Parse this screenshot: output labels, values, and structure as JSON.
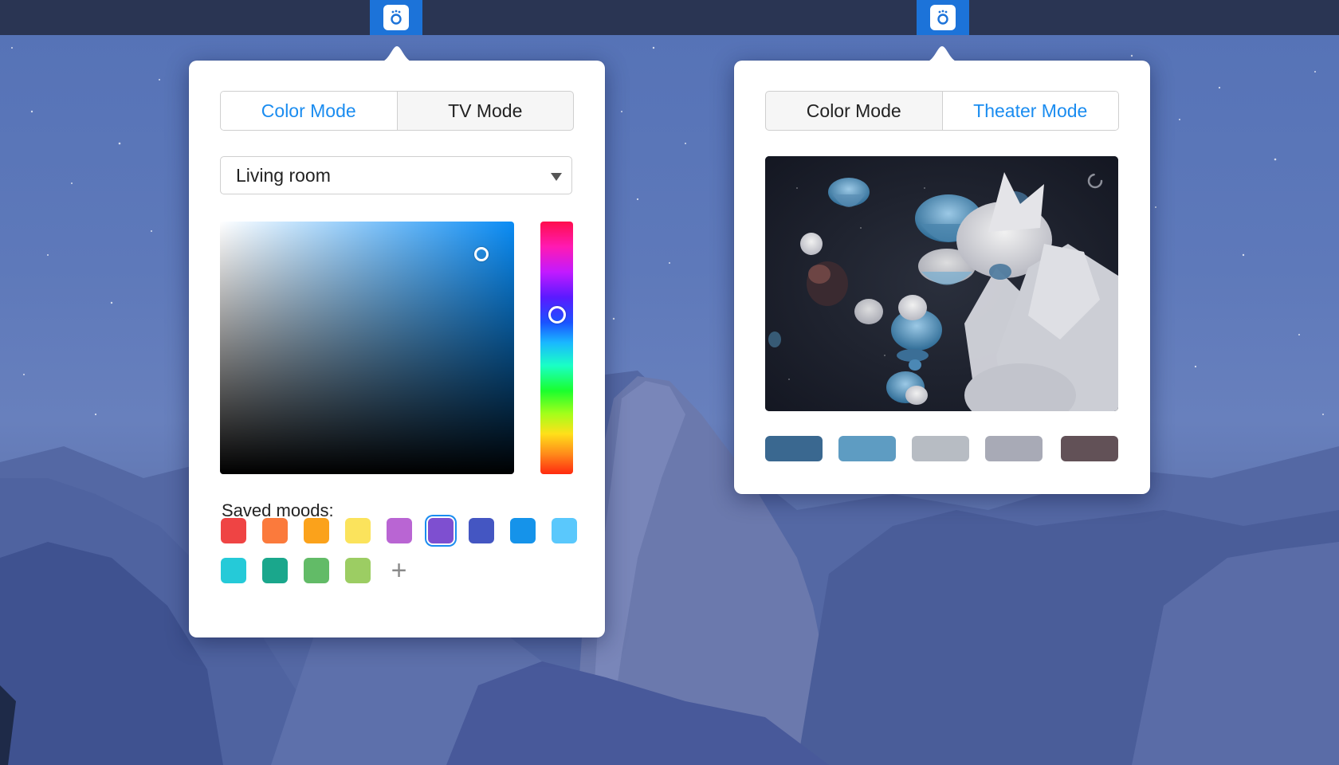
{
  "menubar": {
    "icon_left": "smart-light-app-icon",
    "icon_right": "smart-light-app-icon",
    "accent": "#1c73d9"
  },
  "color_popover": {
    "tabs": [
      {
        "label": "Color Mode",
        "active": true
      },
      {
        "label": "TV Mode",
        "active": false
      }
    ],
    "room_select": {
      "value": "Living room"
    },
    "color_picker": {
      "hue_color": "#0a8cf5",
      "saturation": 0.89,
      "brightness": 0.87,
      "hue_level": 0.37
    },
    "saved_moods_label": "Saved moods:",
    "saved_moods": [
      {
        "color": "#ef4444"
      },
      {
        "color": "#fb7a3c"
      },
      {
        "color": "#fba21b"
      },
      {
        "color": "#fbe35c"
      },
      {
        "color": "#b965d3"
      },
      {
        "color": "#7e4fd0",
        "selected": true
      },
      {
        "color": "#4456c2"
      },
      {
        "color": "#1593ea"
      },
      {
        "color": "#5ac8fc"
      },
      {
        "color": "#25cad8"
      },
      {
        "color": "#1aa78c"
      },
      {
        "color": "#62bb67"
      },
      {
        "color": "#9ccd63"
      }
    ],
    "add_mood_icon": "plus-icon",
    "add_mood_glyph": "+"
  },
  "theater_popover": {
    "tabs": [
      {
        "label": "Color Mode",
        "active": false
      },
      {
        "label": "Theater Mode",
        "active": true
      }
    ],
    "preview_image": "jellyfish-video-preview",
    "loading_icon": "spinner-icon",
    "extracted_palette": [
      {
        "color": "#3a6890"
      },
      {
        "color": "#5e9cc2"
      },
      {
        "color": "#b7bcc3"
      },
      {
        "color": "#a8aab6"
      },
      {
        "color": "#625157"
      }
    ]
  }
}
